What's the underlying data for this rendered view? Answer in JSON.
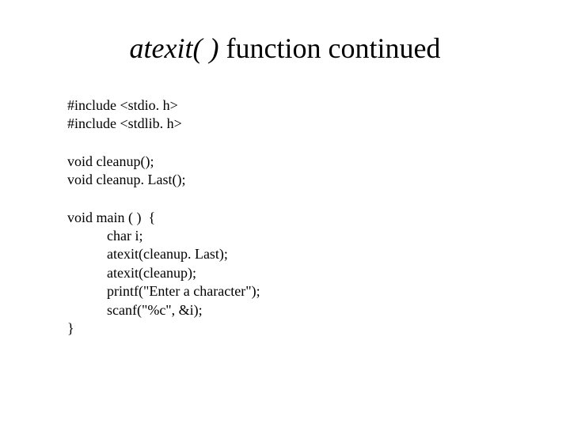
{
  "title": {
    "func": "atexit( )",
    "rest": " function continued"
  },
  "code": {
    "l1": "#include <stdio. h>",
    "l2": "#include <stdlib. h>",
    "l3": "void cleanup();",
    "l4": "void cleanup. Last();",
    "l5": "void main ( )  {",
    "l6": "char i;",
    "l7": "atexit(cleanup. Last);",
    "l8": "atexit(cleanup);",
    "l9": "printf(\"Enter a character\");",
    "l10": "scanf(\"%c\", &i);",
    "l11": "}"
  }
}
